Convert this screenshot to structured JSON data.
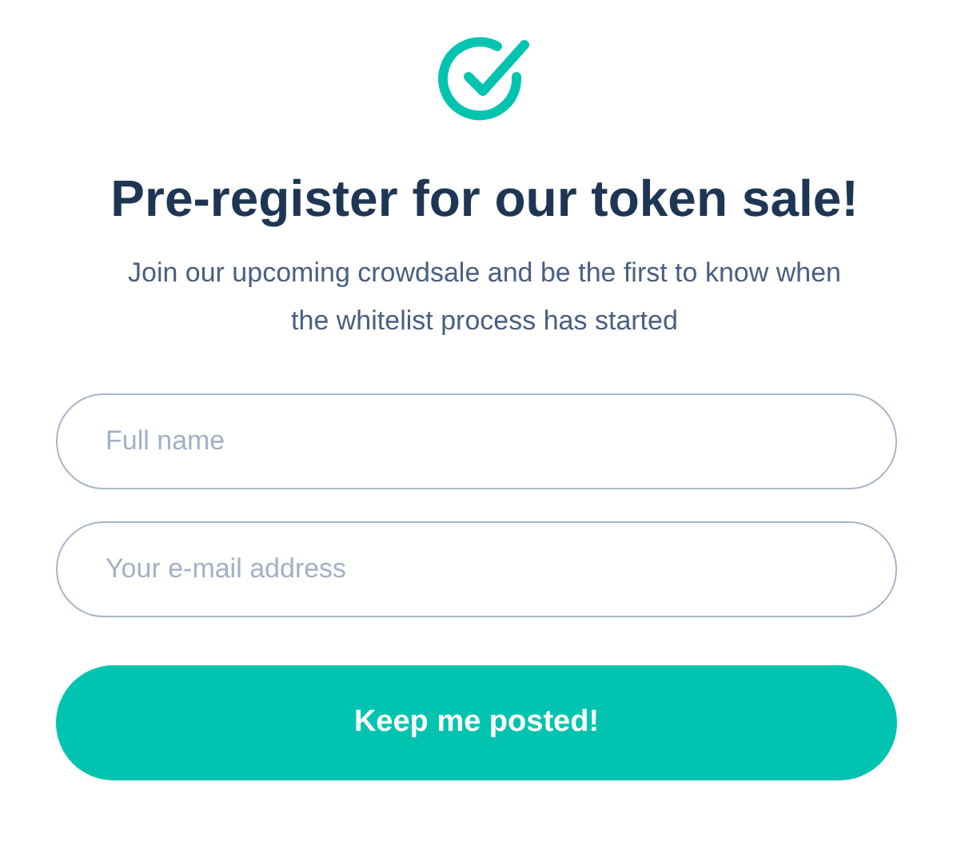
{
  "title": "Pre-register for our token sale!",
  "subtitle": "Join our upcoming crowdsale and be the first to know when the whitelist process has started",
  "fields": [
    {
      "placeholder": "Full name"
    },
    {
      "placeholder": "Your e-mail address"
    }
  ],
  "button": "Keep me posted!"
}
